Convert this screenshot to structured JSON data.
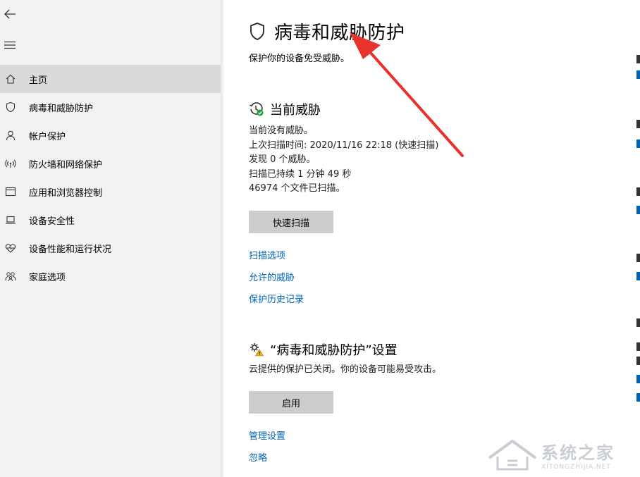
{
  "nav": {
    "items": [
      {
        "label": "主页",
        "icon": "home-icon",
        "active": true
      },
      {
        "label": "病毒和威胁防护",
        "icon": "shield-icon",
        "active": false
      },
      {
        "label": "帐户保护",
        "icon": "person-icon",
        "active": false
      },
      {
        "label": "防火墙和网络保护",
        "icon": "wifi-icon",
        "active": false
      },
      {
        "label": "应用和浏览器控制",
        "icon": "window-icon",
        "active": false
      },
      {
        "label": "设备安全性",
        "icon": "laptop-icon",
        "active": false
      },
      {
        "label": "设备性能和运行状况",
        "icon": "heart-icon",
        "active": false
      },
      {
        "label": "家庭选项",
        "icon": "family-icon",
        "active": false
      }
    ]
  },
  "page": {
    "title": "病毒和威胁防护",
    "subtitle": "保护你的设备免受威胁。"
  },
  "threats": {
    "title": "当前威胁",
    "lines": [
      "当前没有威胁。",
      "上次扫描时间: 2020/11/16 22:18 (快速扫描)",
      "发现 0 个威胁。",
      "扫描已持续 1 分钟 49 秒",
      "46974 个文件已扫描。"
    ],
    "button": "快速扫描",
    "links": [
      "扫描选项",
      "允许的威胁",
      "保护历史记录"
    ]
  },
  "settings": {
    "title": "“病毒和威胁防护”设置",
    "desc": "云提供的保护已关闭。你的设备可能易受攻击。",
    "button": "启用",
    "links": [
      "管理设置",
      "忽略"
    ]
  },
  "watermark": {
    "main": "系统之家",
    "sub": "XITONGZHIJIA.NET"
  },
  "colors": {
    "link": "#0063b1",
    "button": "#cccccc",
    "sidebar": "#f2f2f2",
    "sidebar_active": "#dadada",
    "arrow": "#e8322d"
  }
}
